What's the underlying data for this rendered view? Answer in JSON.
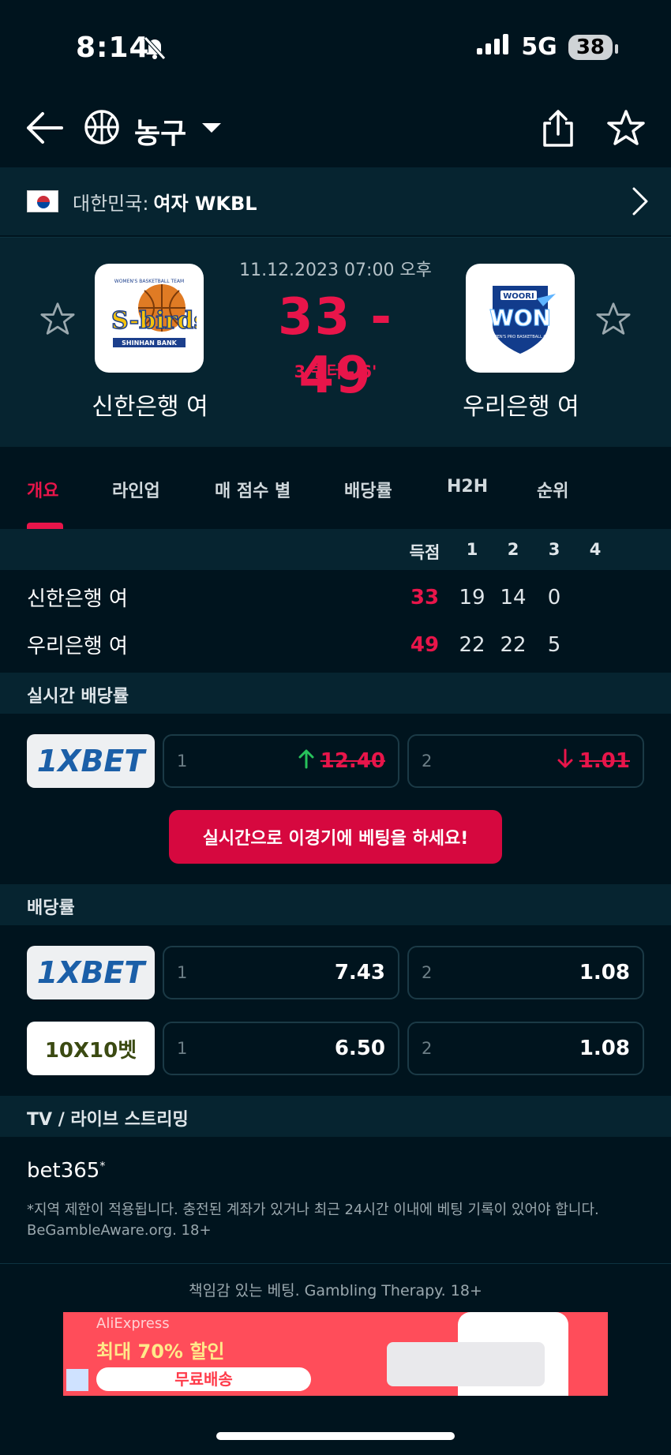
{
  "status": {
    "time": "8:14",
    "network": "5G",
    "battery": "38"
  },
  "header": {
    "sport": "농구"
  },
  "league": {
    "country": "대한민국:",
    "name": "여자 WKBL"
  },
  "match": {
    "datetime": "11.12.2023 07:00 오후",
    "score": "33 - 49",
    "status": "3 쿼터 - 6'",
    "home": {
      "name": "신한은행 여",
      "logo_text": "S-birds",
      "logo_sub": "SHINHAN BANK",
      "logo_top": "WOMEN'S BASKETBALL TEAM"
    },
    "away": {
      "name": "우리은행 여",
      "logo_text": "WON",
      "logo_top": "WOORI",
      "logo_sub": "WOMEN'S PRO BASKETBALL CLUB"
    }
  },
  "tabs": [
    "개요",
    "라인업",
    "매 점수 별",
    "배당률",
    "H2H",
    "순위"
  ],
  "scoreboard": {
    "headers": [
      "득점",
      "1",
      "2",
      "3",
      "4"
    ],
    "rows": [
      {
        "team": "신한은행 여",
        "total": "33",
        "q": [
          "19",
          "14",
          "0",
          ""
        ]
      },
      {
        "team": "우리은행 여",
        "total": "49",
        "q": [
          "22",
          "22",
          "5",
          ""
        ]
      }
    ]
  },
  "live_odds": {
    "title": "실시간 배당률",
    "bookie": "1XBET",
    "odds": [
      {
        "idx": "1",
        "value": "12.40",
        "trend": "up"
      },
      {
        "idx": "2",
        "value": "1.01",
        "trend": "down"
      }
    ],
    "cta": "실시간으로 이경기에 베팅을 하세요!"
  },
  "odds": {
    "title": "배당률",
    "rows": [
      {
        "bookie": "1XBET",
        "o1": "7.43",
        "o2": "1.08"
      },
      {
        "bookie": "10X10벳",
        "o1": "6.50",
        "o2": "1.08"
      }
    ],
    "idx1": "1",
    "idx2": "2"
  },
  "tv": {
    "title": "TV / 라이브 스트리밍",
    "provider": "bet365",
    "note": "*지역 제한이 적용됩니다. 충전된 계좌가 있거나 최근 24시간 이내에 베팅 기록이 있어야 합니다. BeGambleAware.org. 18+"
  },
  "footer": {
    "responsible": "책임감 있는 베팅. Gambling Therapy. 18+"
  },
  "ad": {
    "brand": "AliExpress",
    "headline": "최대 70% 할인",
    "button": "무료배송"
  },
  "colors": {
    "accent": "#e8154a",
    "bg": "#00141e",
    "panel": "#062430",
    "up": "#27c25b"
  }
}
